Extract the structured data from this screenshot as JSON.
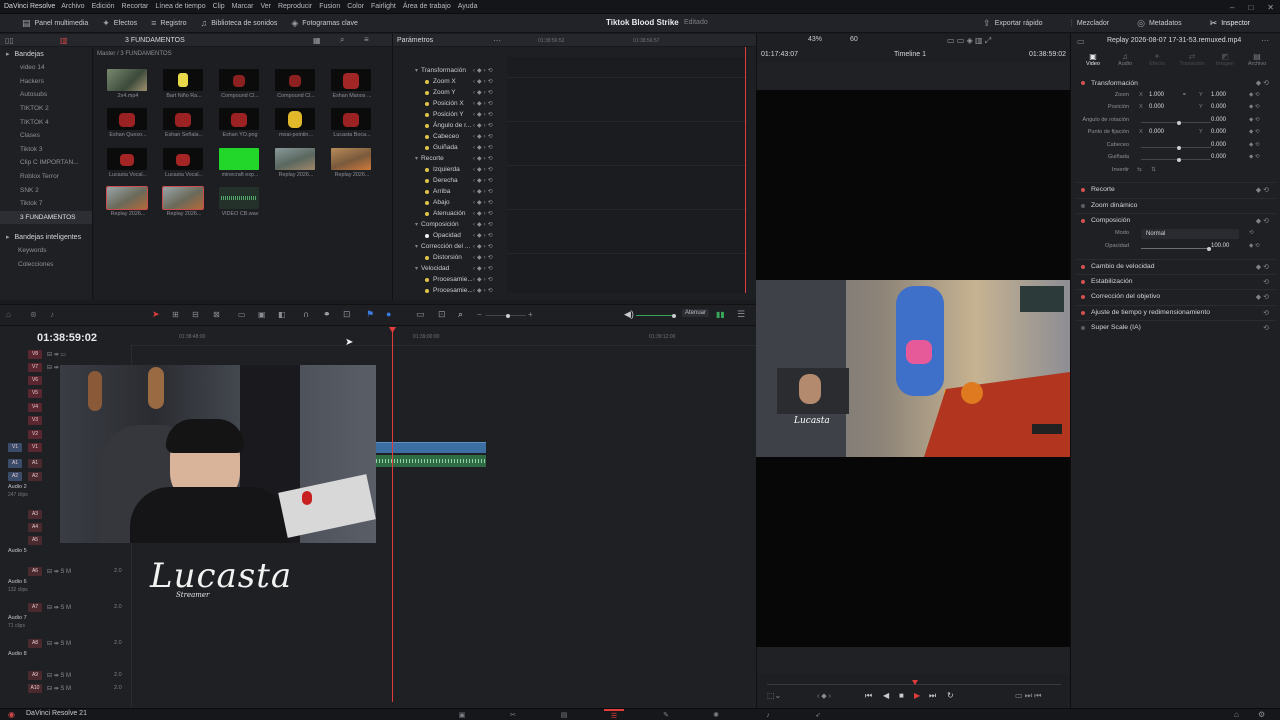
{
  "menubar": {
    "app": "DaVinci Resolve",
    "items": [
      "Archivo",
      "Edición",
      "Recortar",
      "Línea de tiempo",
      "Clip",
      "Marcar",
      "Ver",
      "Reproducir",
      "Fusion",
      "Color",
      "Fairlight",
      "Área de trabajo",
      "Ayuda"
    ]
  },
  "toolbar": {
    "media": "Panel multimedia",
    "effects": "Efectos",
    "index": "Registro",
    "sound": "Biblioteca de sonidos",
    "keyframes": "Fotogramas clave",
    "project": "Tiktok Blood Strike",
    "project_state": "Editado",
    "quick_export": "Exportar rápido",
    "mixer": "Mezclador",
    "metadata": "Metadatos",
    "inspector": "Inspector"
  },
  "bins": {
    "header": "Bandejas",
    "items": [
      "video 14",
      "Hackers",
      "Autosubs",
      "TIKTOK 2",
      "TIKTOK 4",
      "Clases",
      "Tiktok 3",
      "Clip C IMPORTAN...",
      "Roblox Terror",
      "SNK 2",
      "Tiktok 7",
      "3 FUNDAMENTOS"
    ],
    "smart": "Bandejas inteligentes",
    "smart_items": [
      "Keywords",
      "Colecciones"
    ]
  },
  "pool": {
    "path": "Master / 3 FUNDAMENTOS",
    "bin_title": "3 FUNDAMENTOS",
    "clips": [
      "2x4.mp4",
      "Bart Niño Ra...",
      "Compound Cl...",
      "Compound Cl...",
      "Eshan Manos ...",
      "Eshan Queso...",
      "Eshan Señala...",
      "Eshan YO.png",
      "moai-pointin...",
      "Lucasta Boca...",
      "Lucasta Vocal...",
      "Lucasta Vocal...",
      "minecraft exp...",
      "Replay 2026...",
      "Replay 2026...",
      "Replay 2026...",
      "Replay 2026...",
      "VIDEO CB.wav"
    ]
  },
  "params": {
    "title": "Parámetros",
    "rows": [
      "Transformación",
      "Zoom X",
      "Zoom Y",
      "Posición X",
      "Posición Y",
      "Ángulo de r...",
      "Cabeceo",
      "Guiñada",
      "Recorte",
      "Izquierda",
      "Derecha",
      "Arriba",
      "Abajo",
      "Atenuación",
      "Composición",
      "Opacidad",
      "Corrección del ...",
      "Distorsión",
      "Velocidad",
      "Procesamie...",
      "Procesamie..."
    ],
    "tc1": "01:38:56:52",
    "tc2": "01:38:56:57"
  },
  "timeline": {
    "timecode": "01:38:59:02",
    "ruler": [
      "01:38:48:00",
      "01:39:00:00",
      "01:39:12:00"
    ],
    "attenuate": "Atenuar",
    "video_tracks": [
      "V8",
      "V7",
      "V6",
      "V5",
      "V4",
      "V3",
      "V2",
      "V1"
    ],
    "audio": [
      {
        "id": "A1",
        "name": ""
      },
      {
        "id": "A2",
        "name": "Audio 2",
        "sub": "247 clips",
        "val": "2.0"
      },
      {
        "id": "A3",
        "name": "",
        "val": "2.0"
      },
      {
        "id": "A4",
        "name": "",
        "val": "2.0"
      },
      {
        "id": "A5",
        "name": "Audio 5",
        "val": "2.0"
      },
      {
        "id": "A6",
        "name": "Audio 6",
        "sub": "132 clips",
        "val": "2.0"
      },
      {
        "id": "A7",
        "name": "Audio 7",
        "sub": "71 clips",
        "val": "2.0"
      },
      {
        "id": "A8",
        "name": "Audio 8",
        "val": "2.0"
      },
      {
        "id": "A9",
        "name": "",
        "val": "2.0"
      },
      {
        "id": "A10",
        "name": "",
        "val": "2.0"
      }
    ],
    "logo": "Lucasta",
    "logo_sub": "Streamer"
  },
  "viewer": {
    "zoom": "43%",
    "fps": "60",
    "tc_left": "01:17:43:07",
    "timeline_name": "Timeline 1",
    "tc_right": "01:38:59:02",
    "hud_name": "Lucasta"
  },
  "inspector": {
    "clip": "Replay 2026-08-07 17-31-53.remuxed.mp4",
    "tabs": [
      "Video",
      "Audio",
      "Efecto",
      "Transición",
      "Imagen",
      "Archivo"
    ],
    "transform": "Transformación",
    "zoom": "Zoom",
    "zoom_x": "1.000",
    "zoom_y": "1.000",
    "position": "Posición",
    "pos_x": "0.000",
    "pos_y": "0.000",
    "rotation": "Ángulo de rotación",
    "rot_v": "0.000",
    "anchor": "Punto de fijación",
    "anc_x": "0.000",
    "anc_y": "0.000",
    "pitch": "Cabeceo",
    "pitch_v": "0.000",
    "yaw": "Guiñada",
    "yaw_v": "0.000",
    "flip": "Invertir",
    "sections": [
      "Recorte",
      "Zoom dinámico",
      "Composición",
      "Cambio de velocidad",
      "Estabilización",
      "Corrección del objetivo",
      "Ajuste de tiempo y redimensionamiento",
      "Super Scale (IA)"
    ],
    "mode_label": "Modo",
    "mode": "Normal",
    "opacity_label": "Opacidad",
    "opacity": "100.00"
  },
  "status": {
    "name": "DaVinci Resolve 21"
  },
  "colors": {
    "accent": "#e03c3c",
    "video_clip": "#3b6ea2",
    "audio_clip": "#2f6b45"
  }
}
